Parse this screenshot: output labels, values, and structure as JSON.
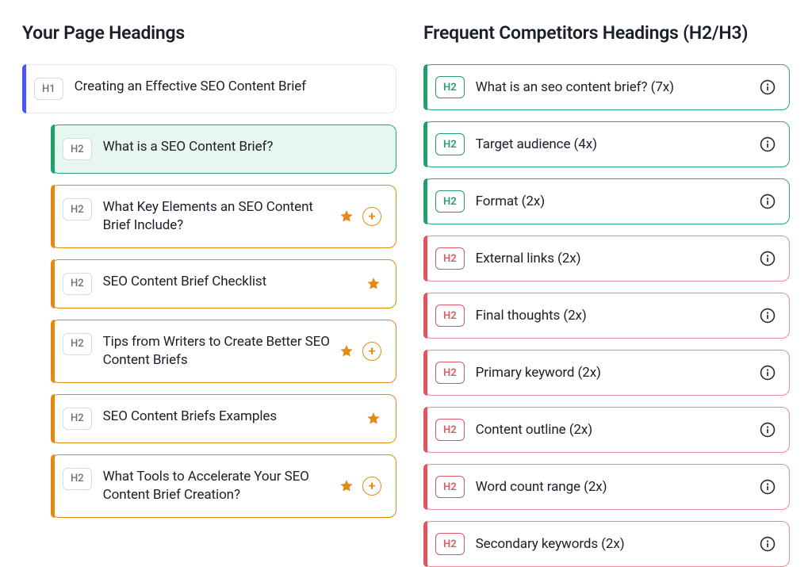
{
  "left": {
    "title": "Your Page Headings",
    "items": [
      {
        "level": "H1",
        "text": "Creating an Effective SEO Content Brief",
        "variant": "h1",
        "indent": false,
        "star": false,
        "plus": false
      },
      {
        "level": "H2",
        "text": "What is a SEO Content Brief?",
        "variant": "green",
        "indent": true,
        "star": false,
        "plus": false
      },
      {
        "level": "H2",
        "text": "What Key Elements an SEO Content Brief Include?",
        "variant": "orange",
        "indent": true,
        "star": true,
        "plus": true
      },
      {
        "level": "H2",
        "text": "SEO Content Brief Checklist",
        "variant": "orange",
        "indent": true,
        "star": true,
        "plus": false
      },
      {
        "level": "H2",
        "text": "Tips from Writers to Create Better SEO Content Briefs",
        "variant": "orange",
        "indent": true,
        "star": true,
        "plus": true
      },
      {
        "level": "H2",
        "text": "SEO Content Briefs Examples",
        "variant": "orange",
        "indent": true,
        "star": true,
        "plus": false
      },
      {
        "level": "H2",
        "text": "What Tools to Accelerate Your SEO Content Brief Creation?",
        "variant": "orange",
        "indent": true,
        "star": true,
        "plus": true
      }
    ]
  },
  "right": {
    "title": "Frequent Competitors Headings (H2/H3)",
    "items": [
      {
        "level": "H2",
        "text": "What is an seo content brief? (7x)",
        "variant": "green"
      },
      {
        "level": "H2",
        "text": "Target audience (4x)",
        "variant": "green"
      },
      {
        "level": "H2",
        "text": "Format (2x)",
        "variant": "green"
      },
      {
        "level": "H2",
        "text": "External links (2x)",
        "variant": "red"
      },
      {
        "level": "H2",
        "text": "Final thoughts (2x)",
        "variant": "red"
      },
      {
        "level": "H2",
        "text": "Primary keyword (2x)",
        "variant": "red"
      },
      {
        "level": "H2",
        "text": "Content outline (2x)",
        "variant": "red"
      },
      {
        "level": "H2",
        "text": "Word count range (2x)",
        "variant": "red"
      },
      {
        "level": "H2",
        "text": "Secondary keywords (2x)",
        "variant": "red"
      }
    ]
  }
}
